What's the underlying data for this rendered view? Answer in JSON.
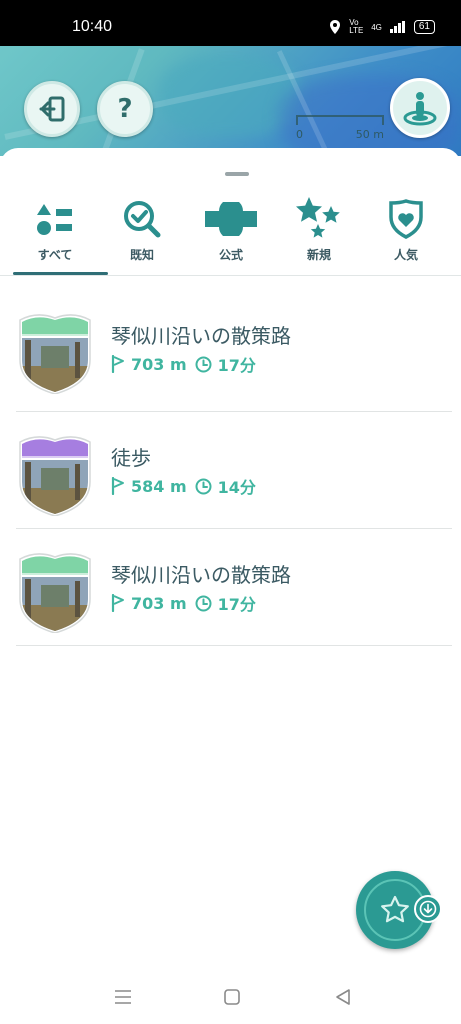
{
  "status_bar": {
    "time": "10:40",
    "network": "Vo LTE",
    "signal": "4G",
    "battery": "61"
  },
  "map": {
    "scale_left": "0",
    "scale_right": "50 m"
  },
  "filter_tabs": [
    {
      "label": "すべて",
      "icon": "all-list-icon",
      "selected": true
    },
    {
      "label": "既知",
      "icon": "magnifier-check-icon",
      "selected": false
    },
    {
      "label": "公式",
      "icon": "banner-icon",
      "selected": false
    },
    {
      "label": "新規",
      "icon": "stars-icon",
      "selected": false
    },
    {
      "label": "人気",
      "icon": "heart-shield-icon",
      "selected": false
    }
  ],
  "routes": [
    {
      "title": "琴似川沿いの散策路",
      "distance": "703 m",
      "duration": "17分",
      "badge_color": "#7fd4a6"
    },
    {
      "title": "徒歩",
      "distance": "584 m",
      "duration": "14分",
      "badge_color": "#a67ee0"
    },
    {
      "title": "琴似川沿いの散策路",
      "distance": "703 m",
      "duration": "17分",
      "badge_color": "#7fd4a6"
    }
  ],
  "colors": {
    "accent": "#2b9a93",
    "meta_text": "#40b5a0",
    "title_text": "#3b5a63"
  }
}
